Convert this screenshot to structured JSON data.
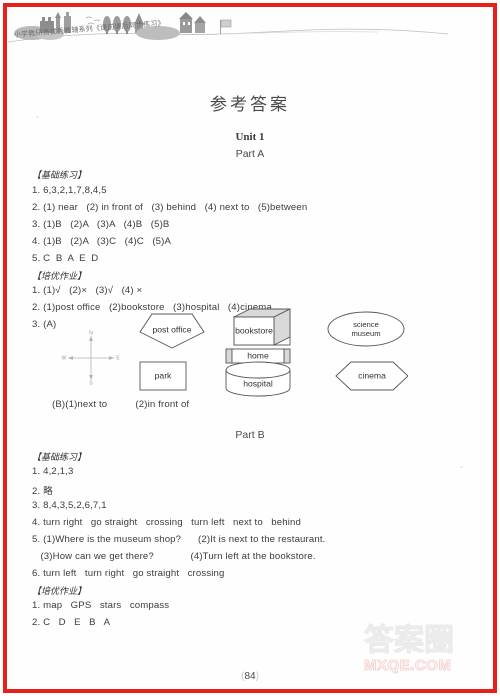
{
  "banner": {
    "caption": "小学教研员优秀教辅系列《课前课后同步练习》",
    "illustration_name": "townscape-illustration"
  },
  "document": {
    "title": "参考答案",
    "unit": "Unit 1"
  },
  "sections": [
    {
      "part_label": "Part A",
      "blocks": [
        {
          "tag": "【基础练习】",
          "lines": [
            "1. 6,3,2,1,7,8,4,5",
            "2. (1) near   (2) in front of   (3) behind   (4) next to   (5)between",
            "3. (1)B   (2)A   (3)A   (4)B   (5)B",
            "4. (1)B   (2)A   (3)C   (4)C   (5)A",
            "5. C  B  A  E  D"
          ]
        },
        {
          "tag": "【培优作业】",
          "lines": [
            "1. (1)√   (2)×   (3)√   (4) ×",
            "2. (1)post office   (2)bookstore   (3)hospital   (4)cinema",
            "3. (A)"
          ]
        }
      ]
    },
    {
      "part_label": "Part B",
      "blocks": [
        {
          "tag": "【基础练习】",
          "lines": [
            "1. 4,2,1,3",
            "2. 略",
            "3. 8,4,3,5,2,6,7,1",
            "4. turn right   go straight   crossing   turn left   next to   behind",
            "5. (1)Where is the museum shop?      (2)It is next to the restaurant.",
            "   (3)How can we get there?             (4)Turn left at the bookstore.",
            "6. turn left   turn right   go straight   crossing"
          ]
        },
        {
          "tag": "【培优作业】",
          "lines": [
            "1. map   GPS   stars   compass",
            "2. C   D   E   B   A"
          ]
        }
      ]
    }
  ],
  "diagram": {
    "caption": "(B)(1)next to          (2)in front of",
    "compass": {
      "north": "N",
      "south": "S",
      "east": "E",
      "west": "W"
    },
    "shapes": [
      {
        "id": "post-office",
        "label": "post office",
        "shape": "pentagon"
      },
      {
        "id": "bookstore",
        "label": "bookstore",
        "shape": "3d-box"
      },
      {
        "id": "science-museum",
        "label_line1": "science",
        "label_line2": "museum",
        "shape": "ellipse"
      },
      {
        "id": "home",
        "label": "home",
        "shape": "banner-bar"
      },
      {
        "id": "park",
        "label": "park",
        "shape": "rectangle"
      },
      {
        "id": "hospital",
        "label": "hospital",
        "shape": "cylinder"
      },
      {
        "id": "cinema",
        "label": "cinema",
        "shape": "hexagon"
      }
    ]
  },
  "footer": {
    "page_number": "84",
    "paren_left": "(",
    "paren_right": ")"
  },
  "watermark": {
    "chinese": "答案圈",
    "domain": "MXQE.COM"
  },
  "colors": {
    "frame_red": "#e8201a",
    "text": "#3c3c3c",
    "watermark_grey": "#dcdcdc",
    "watermark_pink": "#f0b5b0"
  }
}
